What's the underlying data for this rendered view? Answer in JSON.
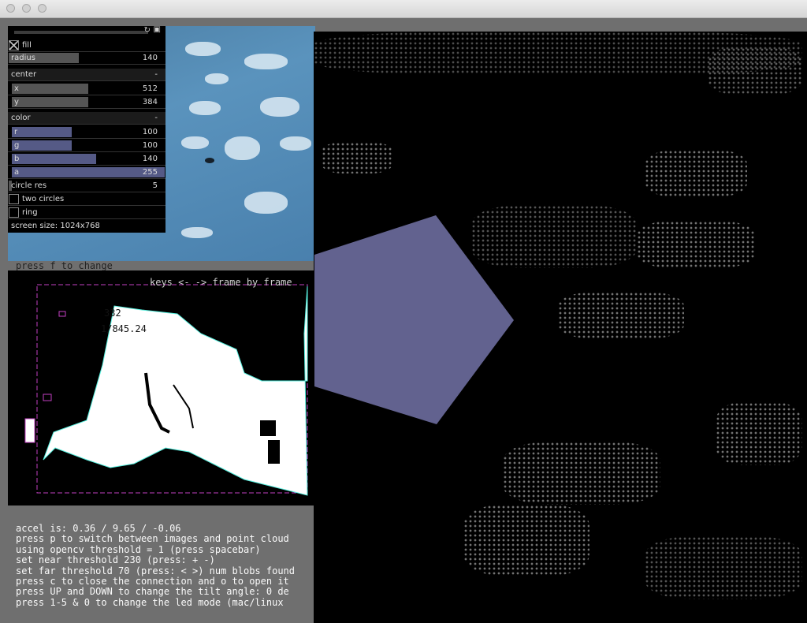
{
  "window": {
    "title": ""
  },
  "gui": {
    "fill_label": "fill",
    "radius": {
      "label": "radius",
      "value": "140",
      "fraction": 0.44
    },
    "center": {
      "label": "center",
      "collapse": "-",
      "x": {
        "label": "x",
        "value": "512",
        "fraction": 0.5
      },
      "y": {
        "label": "y",
        "value": "384",
        "fraction": 0.5
      }
    },
    "color": {
      "label": "color",
      "collapse": "-",
      "r": {
        "label": "r",
        "value": "100",
        "fraction": 0.39
      },
      "g": {
        "label": "g",
        "value": "100",
        "fraction": 0.39
      },
      "b": {
        "label": "b",
        "value": "140",
        "fraction": 0.55
      },
      "a": {
        "label": "a",
        "value": "255",
        "fraction": 1.0
      }
    },
    "circle_res": {
      "label": "circle res",
      "value": "5"
    },
    "two_circles_label": "two circles",
    "ring_label": "ring",
    "screen_size": "screen size: 1024x768"
  },
  "overlay_texts": {
    "press_f": "press f to change",
    "keys": "keys <- -> frame by frame",
    "num1": "332",
    "num2": "1/845.24"
  },
  "status_lines": [
    "accel is: 0.36 / 9.65 / -0.06",
    "press p to switch between images and point cloud",
    "using opencv threshold = 1 (press spacebar)",
    "set near threshold 230 (press: + -)",
    "set far threshold 70 (press: < >) num blobs found",
    "press c to close the connection and o to open it",
    "press UP and DOWN to change the tilt angle: 0 de",
    "press 1-5 & 0 to change the led mode (mac/linux"
  ],
  "colors": {
    "pentagon": "#62628f",
    "slider_fill": "#555a86"
  }
}
